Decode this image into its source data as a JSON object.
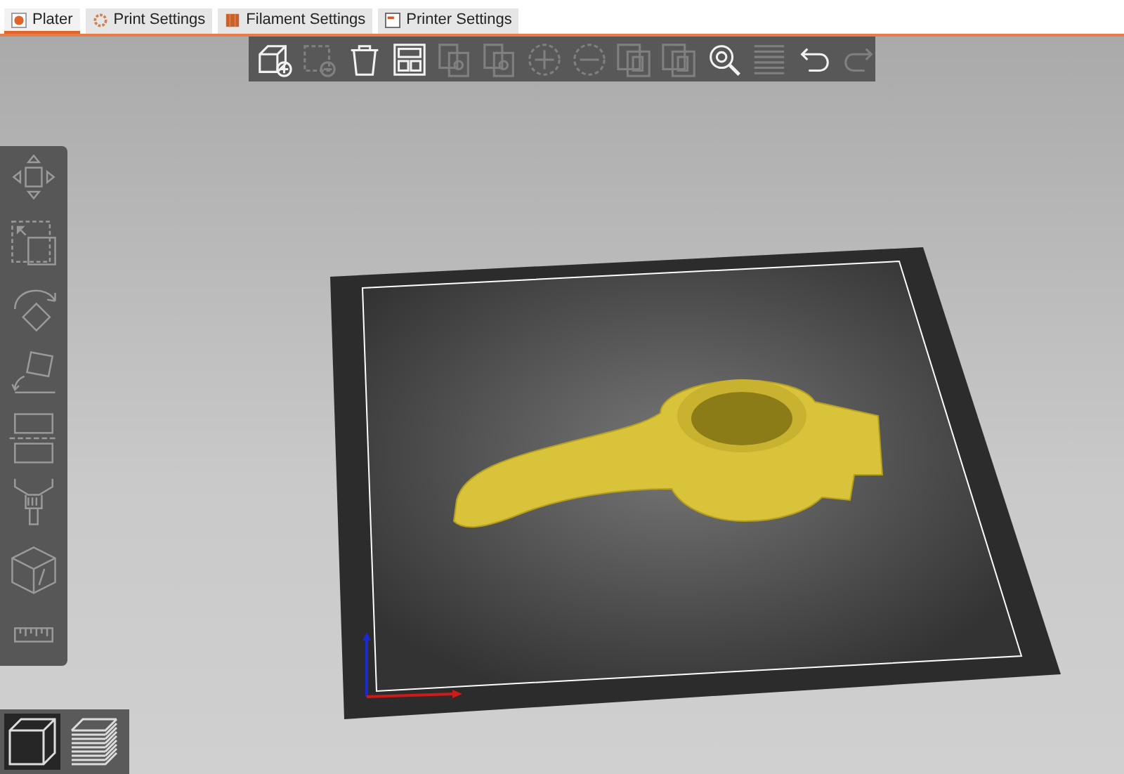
{
  "tabs": [
    {
      "label": "Plater",
      "kind": "plater",
      "selected": true
    },
    {
      "label": "Print Settings",
      "kind": "print",
      "selected": false
    },
    {
      "label": "Filament Settings",
      "kind": "filament",
      "selected": false
    },
    {
      "label": "Printer Settings",
      "kind": "printer",
      "selected": false
    }
  ],
  "toolbar": [
    {
      "kind": "add",
      "disabled": false
    },
    {
      "kind": "delete",
      "disabled": true
    },
    {
      "kind": "delete-all",
      "disabled": false
    },
    {
      "kind": "arrange",
      "disabled": false
    },
    {
      "kind": "copy",
      "disabled": true
    },
    {
      "kind": "paste",
      "disabled": true
    },
    {
      "kind": "plus",
      "disabled": true
    },
    {
      "kind": "minus",
      "disabled": true
    },
    {
      "kind": "split-objects",
      "disabled": true
    },
    {
      "kind": "split-parts",
      "disabled": true
    },
    {
      "kind": "search",
      "disabled": false
    },
    {
      "kind": "layers",
      "disabled": true
    },
    {
      "kind": "undo",
      "disabled": false
    },
    {
      "kind": "redo",
      "disabled": true
    }
  ],
  "side_tools": [
    {
      "kind": "move"
    },
    {
      "kind": "scale"
    },
    {
      "kind": "rotate"
    },
    {
      "kind": "place"
    },
    {
      "kind": "cut"
    },
    {
      "kind": "paint"
    },
    {
      "kind": "hollow"
    },
    {
      "kind": "measure"
    }
  ],
  "views": [
    {
      "kind": "cube",
      "selected": true
    },
    {
      "kind": "layers",
      "selected": false
    }
  ]
}
